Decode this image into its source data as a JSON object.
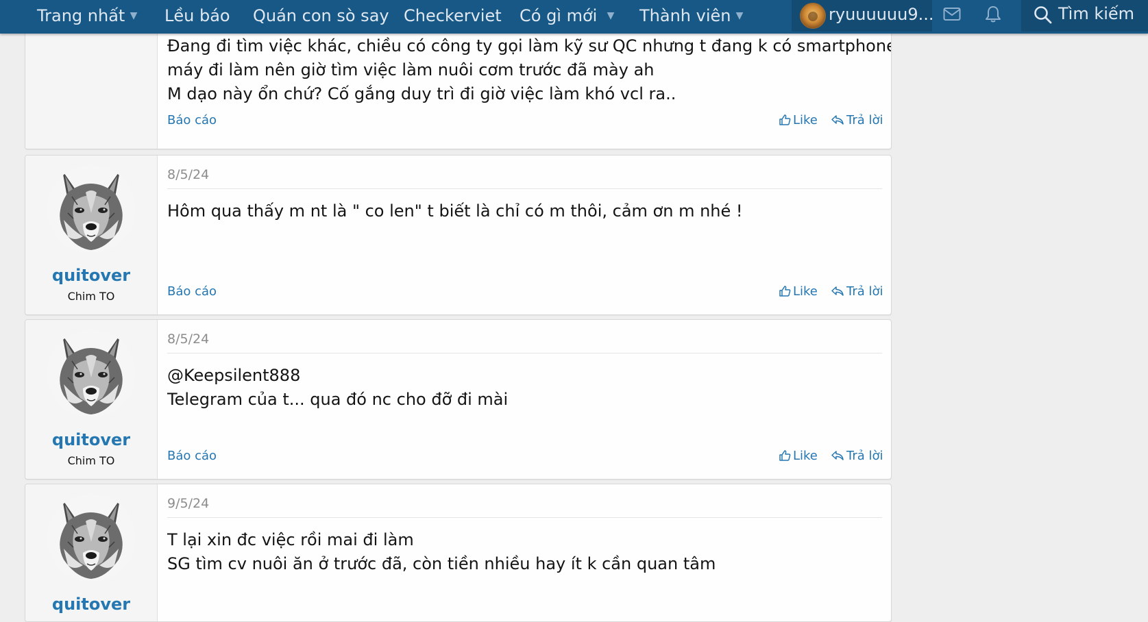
{
  "nav": {
    "items": [
      {
        "label": "Trang nhất",
        "has_dropdown": true
      },
      {
        "label": "Lều báo",
        "has_dropdown": false
      },
      {
        "label": "Quán con sò say",
        "has_dropdown": false
      },
      {
        "label": "Checkerviet",
        "has_dropdown": false
      },
      {
        "label": "Có gì mới",
        "has_dropdown": true
      },
      {
        "label": "Thành viên",
        "has_dropdown": true
      }
    ],
    "account_name": "ryuuuuuu9...",
    "search_label": "Tìm kiếm",
    "icons": [
      "chevron-down-icon",
      "envelope-icon",
      "bell-icon",
      "search-icon"
    ],
    "colors": {
      "bar": "#185886",
      "active": "#134b73"
    }
  },
  "posts": [
    {
      "lines": [
        "Đang đi tìm việc khác, chiều có công ty gọi làm kỹ sư QC nhưng t đang k có smartphone và xe",
        "máy đi làm nên giờ tìm việc làm nuôi cơm trước đã mày ah",
        "M dạo này ổn chứ? Cố gắng duy trì đi giờ việc làm khó vcl ra.."
      ],
      "report": "Báo cáo",
      "like": "Like",
      "reply": "Trả lời"
    },
    {
      "author": "quitover",
      "user_title": "Chim TO",
      "date": "8/5/24",
      "lines": [
        "Hôm qua thấy m nt là \" co len\" t biết là chỉ có m thôi, cảm ơn m nhé !"
      ],
      "report": "Báo cáo",
      "like": "Like",
      "reply": "Trả lời"
    },
    {
      "author": "quitover",
      "user_title": "Chim TO",
      "date": "8/5/24",
      "lines": [
        "@Keepsilent888",
        "Telegram của t... qua đó nc cho đỡ đi mài"
      ],
      "report": "Báo cáo",
      "like": "Like",
      "reply": "Trả lời"
    },
    {
      "author": "quitover",
      "date": "9/5/24",
      "lines": [
        "T lại xin đc việc rồi mai đi làm",
        "SG tìm cv nuôi ăn ở trước đã, còn tiền nhiều hay ít k cần quan tâm"
      ]
    }
  ],
  "colors": {
    "link": "#2577b1",
    "date": "#8c8c8c",
    "page_bg": "#eeeeee"
  }
}
